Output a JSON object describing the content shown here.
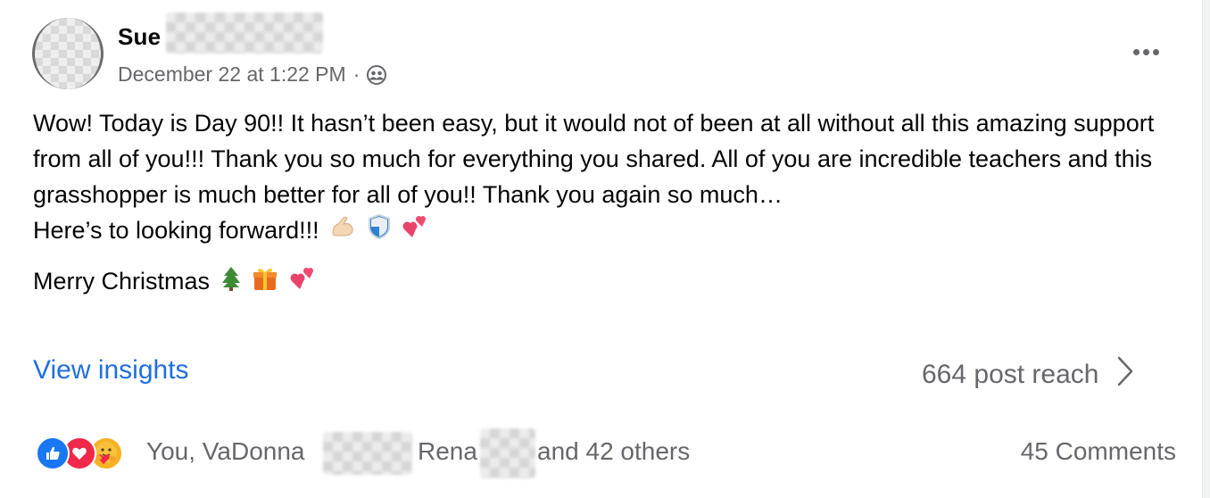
{
  "post": {
    "author_name": "Sue",
    "timestamp": "December 22 at 1:22 PM",
    "separator": "·",
    "audience_icon": "friends-icon",
    "more_icon": "ellipsis-icon",
    "paragraphs": [
      "Wow! Today is Day 90!! It hasn’t been easy, but it would not of been at all without all this amazing support from all of you!!! Thank you so much for everything you shared. All of you are incredible teachers and this grasshopper is much better for all of you!! Thank you again so much…",
      "Here’s to looking forward!!!",
      "Merry Christmas"
    ],
    "emojis_line2": [
      "flexed-biceps-icon",
      "shield-icon",
      "two-hearts-icon"
    ],
    "emojis_line3": [
      "christmas-tree-icon",
      "gift-icon",
      "two-hearts-icon"
    ]
  },
  "insights": {
    "view_label": "View insights",
    "reach_label": "664 post reach",
    "chevron_icon": "chevron-right-icon"
  },
  "reactions": {
    "icons": [
      "like-icon",
      "love-icon",
      "care-icon"
    ],
    "name_1": "You, VaDonna",
    "name_2": "Rena",
    "others": "and 42 others",
    "comments_label": "45 Comments"
  },
  "colors": {
    "link_blue": "#216fdb",
    "secondary_text": "#65676b",
    "like_blue": "#1877f2",
    "love_red": "#f02849",
    "care_yellow": "#f7b125"
  }
}
